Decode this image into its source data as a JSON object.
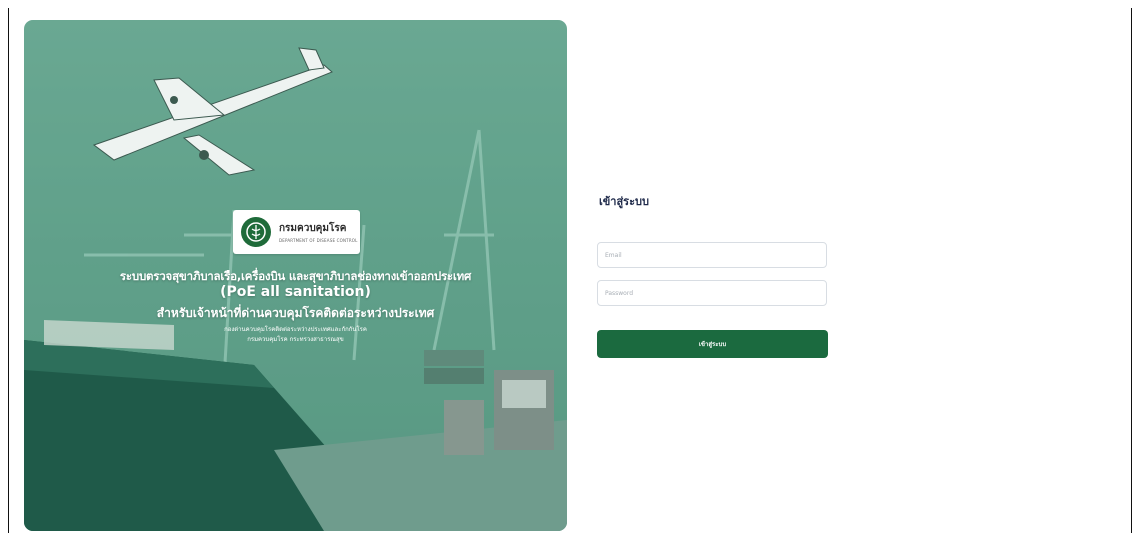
{
  "hero": {
    "logo": {
      "name": "กรมควบคุมโรค",
      "subtitle": "DEPARTMENT OF DISEASE CONTROL"
    },
    "line1": "ระบบตรวจสุขาภิบาลเรือ,เครื่องบิน และสุขาภิบาลช่องทางเข้าออกประเทศ",
    "line2": "(PoE all sanitation)",
    "line3": "สำหรับเจ้าหน้าที่ด่านควบคุมโรคติดต่อระหว่างประเทศ",
    "line4": "กองด่านควบคุมโรคติดต่อระหว่างประเทศและกักกันโรค",
    "line5": "กรมควบคุมโรค กระทรวงสาธารณสุข"
  },
  "login": {
    "title": "เข้าสู่ระบบ",
    "email_placeholder": "Email",
    "password_placeholder": "Password",
    "submit_label": "เข้าสู่ระบบ"
  },
  "colors": {
    "primary": "#1b6a3f",
    "hero_overlay": "#5b9c86"
  }
}
